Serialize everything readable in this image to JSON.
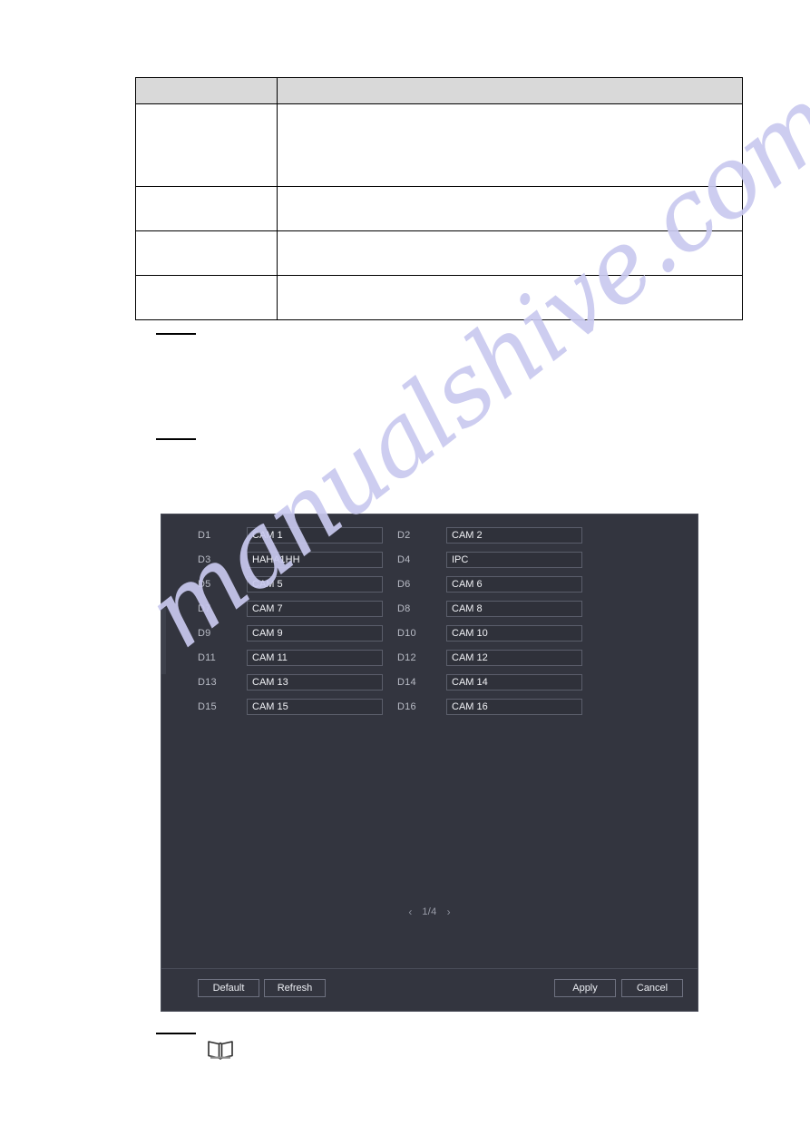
{
  "document": {
    "watermark": "manualshive.com"
  },
  "spec_table": {
    "headers": [
      "",
      ""
    ],
    "rows": [
      {
        "name": "",
        "description": ""
      },
      {
        "name": "",
        "description": ""
      },
      {
        "name": "",
        "description": ""
      },
      {
        "name": "",
        "description": ""
      }
    ]
  },
  "dialog": {
    "pagination": {
      "prev_icon": "‹",
      "label": "1/4",
      "next_icon": "›"
    },
    "buttons": {
      "default": "Default",
      "refresh": "Refresh",
      "apply": "Apply",
      "cancel": "Cancel"
    },
    "channels": [
      {
        "label": "D1",
        "name": "CAM 1"
      },
      {
        "label": "D2",
        "name": "CAM 2"
      },
      {
        "label": "D3",
        "name": "HAHA1HH"
      },
      {
        "label": "D4",
        "name": "IPC"
      },
      {
        "label": "D5",
        "name": "CAM 5"
      },
      {
        "label": "D6",
        "name": "CAM 6"
      },
      {
        "label": "D7",
        "name": "CAM 7"
      },
      {
        "label": "D8",
        "name": "CAM 8"
      },
      {
        "label": "D9",
        "name": "CAM 9"
      },
      {
        "label": "D10",
        "name": "CAM 10"
      },
      {
        "label": "D11",
        "name": "CAM 11"
      },
      {
        "label": "D12",
        "name": "CAM 12"
      },
      {
        "label": "D13",
        "name": "CAM 13"
      },
      {
        "label": "D14",
        "name": "CAM 14"
      },
      {
        "label": "D15",
        "name": "CAM 15"
      },
      {
        "label": "D16",
        "name": "CAM 16"
      }
    ]
  },
  "colors": {
    "dialog_background": "#33353f",
    "input_background": "#2f313a",
    "input_border": "#5b5e6b",
    "text": "#d3d5de",
    "table_header": "#d9d9d9",
    "watermark": "#c9c9ef"
  }
}
